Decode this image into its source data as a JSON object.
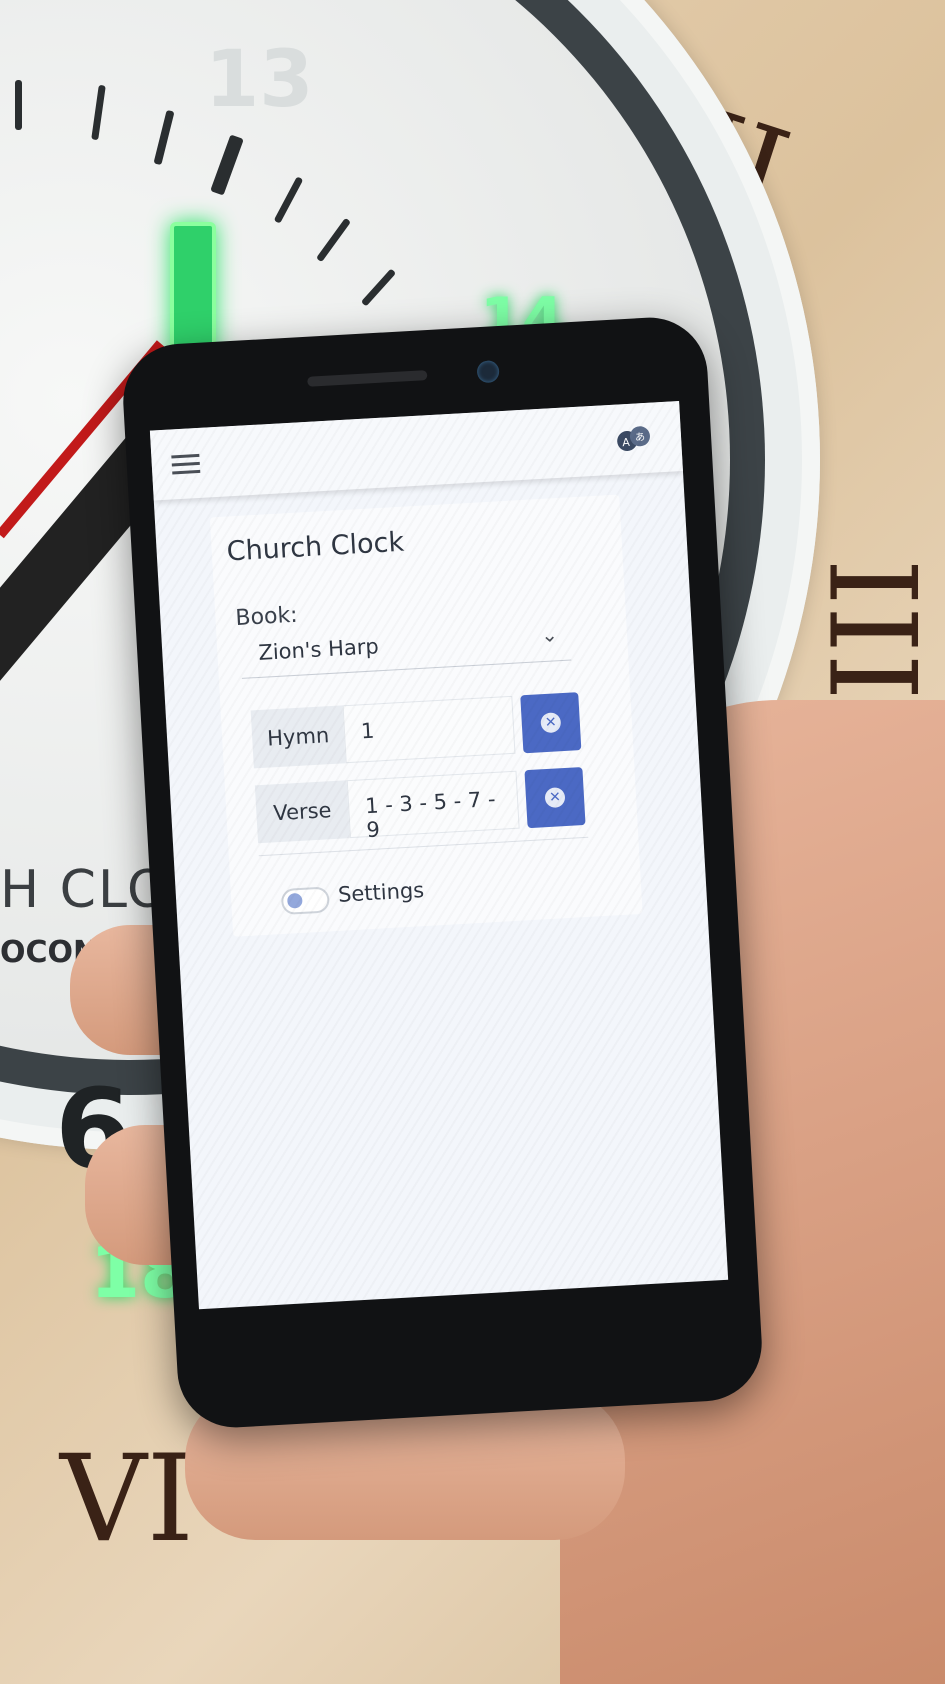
{
  "app": {
    "title": "Church Clock",
    "menu_icon": "hamburger-menu-icon",
    "translate_icon": "translate-icon"
  },
  "form": {
    "book_label": "Book:",
    "book_value": "Zion's Harp",
    "hymn_label": "Hymn",
    "hymn_value": "1",
    "verse_label": "Verse",
    "verse_value": "1 - 3 - 5 - 7 - 9",
    "clear_icon": "clear-icon"
  },
  "settings": {
    "label": "Settings",
    "enabled": false
  },
  "background": {
    "clock_numbers": [
      "13",
      "14",
      "6",
      "18"
    ],
    "roman_numerals": [
      "II",
      "III",
      "VI"
    ],
    "brand_text": "H CLO",
    "brand_text_2": "OCONTRO"
  },
  "colors": {
    "accent": "#4b69c4",
    "led_green": "#2fd06a"
  }
}
